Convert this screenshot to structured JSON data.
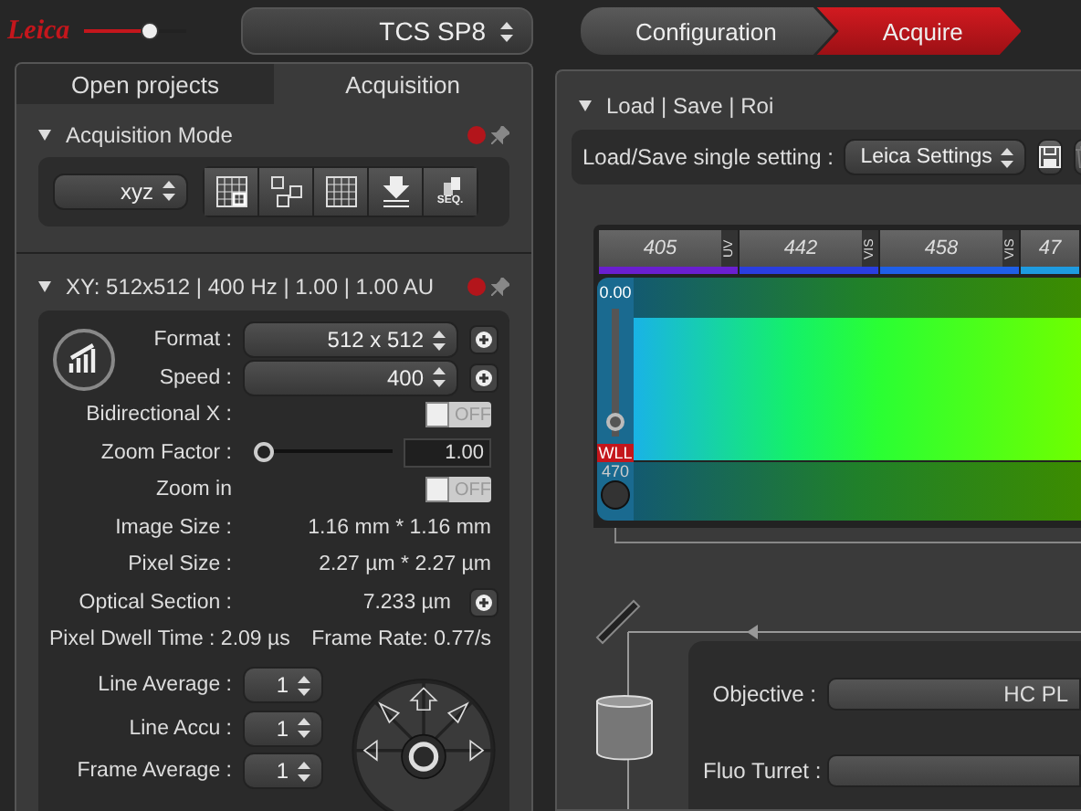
{
  "header": {
    "logo": "Leica",
    "brightness": {
      "level": 0.68
    },
    "system": "TCS SP8"
  },
  "workflow_tabs": [
    {
      "label": "Configuration",
      "selected": false
    },
    {
      "label": "Acquire",
      "selected": true
    }
  ],
  "left_tabs": [
    {
      "label": "Open projects",
      "selected": false
    },
    {
      "label": "Acquisition",
      "selected": true
    }
  ],
  "acquisition_mode": {
    "title": "Acquisition Mode",
    "mode": "xyz",
    "seq_label": "SEQ."
  },
  "scan_settings": {
    "title": "XY: 512x512 | 400 Hz | 1.00 | 1.00 AU",
    "format": {
      "label": "Format :",
      "value": "512 x 512"
    },
    "speed": {
      "label": "Speed :",
      "value": "400"
    },
    "bidirectional": {
      "label": "Bidirectional X :",
      "on": false,
      "text": "OFF"
    },
    "zoom_factor": {
      "label": "Zoom Factor :",
      "level": 0.0,
      "value": "1.00"
    },
    "zoom_in": {
      "label": "Zoom in",
      "on": false,
      "text": "OFF"
    },
    "info": [
      {
        "label": "Image Size :",
        "value": "1.16 mm * 1.16 mm",
        "plus": false
      },
      {
        "label": "Pixel Size :",
        "value": "2.27 µm * 2.27 µm",
        "plus": false
      },
      {
        "label": "Optical Section :",
        "value": "7.233 µm",
        "plus": true
      }
    ],
    "dwell_time": "Pixel Dwell Time : 2.09 µs",
    "frame_rate": "Frame Rate: 0.77/s",
    "averaging": [
      {
        "label": "Line Average :",
        "value": "1"
      },
      {
        "label": "Line Accu :",
        "value": "1"
      },
      {
        "label": "Frame Average :",
        "value": "1"
      }
    ]
  },
  "load_save": {
    "title": "Load | Save | Roi",
    "label": "Load/Save single setting :",
    "value": "Leica Settings"
  },
  "laser_lines": [
    {
      "wavelength": "405",
      "band": "UV",
      "color": "#6a1fd0"
    },
    {
      "wavelength": "442",
      "band": "VIS",
      "color": "#2a3ee0"
    },
    {
      "wavelength": "458",
      "band": "VIS",
      "color": "#1f5fe8"
    },
    {
      "wavelength": "47",
      "color": "#1e9be0"
    }
  ],
  "spectrum": {
    "top_value": "0.00",
    "level": 0.05,
    "badge": "WLL",
    "wavelength": "470"
  },
  "beam_path": {
    "objective": {
      "label": "Objective :",
      "value": "HC PL"
    },
    "fluo_turret": {
      "label": "Fluo Turret :"
    }
  }
}
